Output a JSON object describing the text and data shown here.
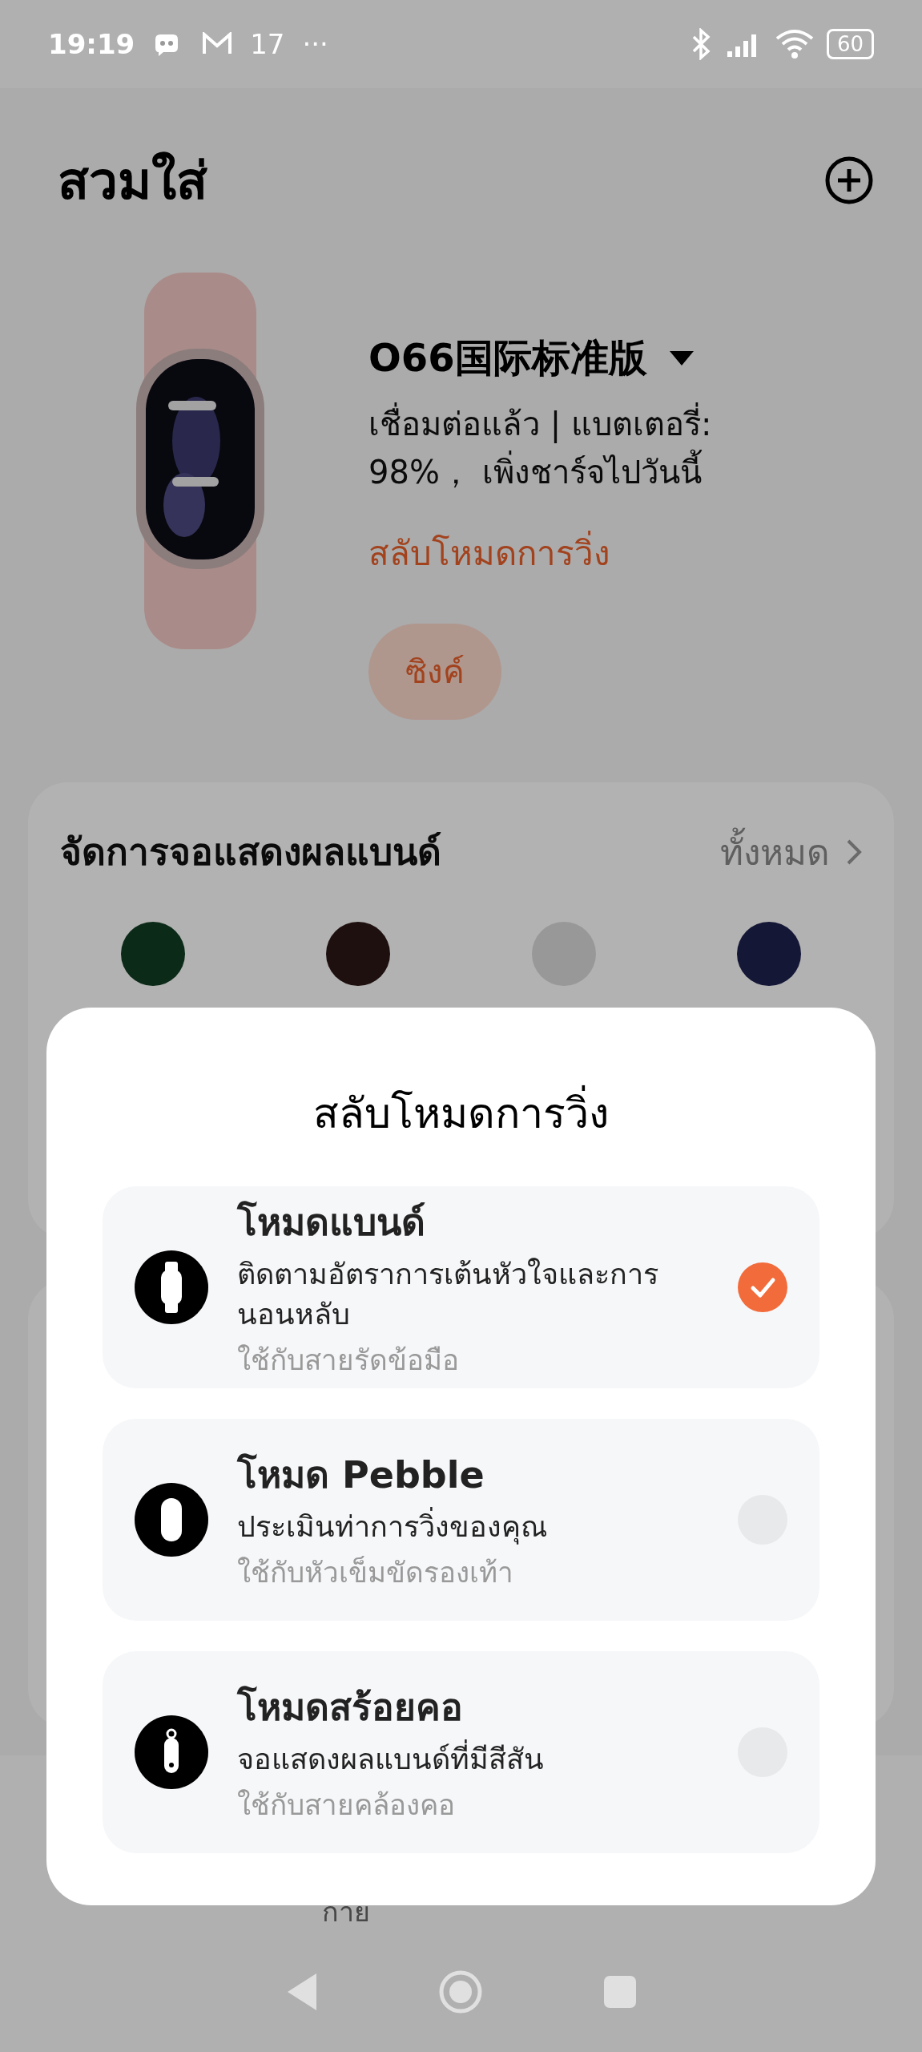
{
  "status_bar": {
    "time": "19:19",
    "notification_count": "17",
    "more": "···",
    "battery": "60"
  },
  "header": {
    "title": "สวมใส่"
  },
  "device": {
    "name": "O66国际标准版",
    "status": "เชื่อมต่อแล้ว | แบตเตอรี่:\n98%， เพิ่งชาร์จไปวันนี้",
    "mode_link": "สลับโหมดการวิ่ง",
    "sync_button": "ซิงค์"
  },
  "faces_card": {
    "title": "จัดการจอแสดงผลแบนด์",
    "all_link": "ทั้งหมด",
    "faces": [
      {
        "color": "#0b2a18"
      },
      {
        "color": "#1f1010"
      },
      {
        "color": "#989898"
      },
      {
        "color": "#141736"
      }
    ]
  },
  "bottom_nav": {
    "visible_label": "กาย"
  },
  "dialog": {
    "title": "สลับโหมดการวิ่ง",
    "options": [
      {
        "kind": "band",
        "title": "โหมดแบนด์",
        "description": "ติดตามอัตราการเต้นหัวใจและการนอนหลับ",
        "hint": "ใช้กับสายรัดข้อมือ",
        "selected": true
      },
      {
        "kind": "pebble",
        "title": "โหมด Pebble",
        "description": "ประเมินท่าการวิ่งของคุณ",
        "hint": "ใช้กับหัวเข็มขัดรองเท้า",
        "selected": false
      },
      {
        "kind": "necklace",
        "title": "โหมดสร้อยคอ",
        "description": "จอแสดงผลแบนด์ที่มีสีสัน",
        "hint": "ใช้กับสายคล้องคอ",
        "selected": false
      }
    ]
  }
}
